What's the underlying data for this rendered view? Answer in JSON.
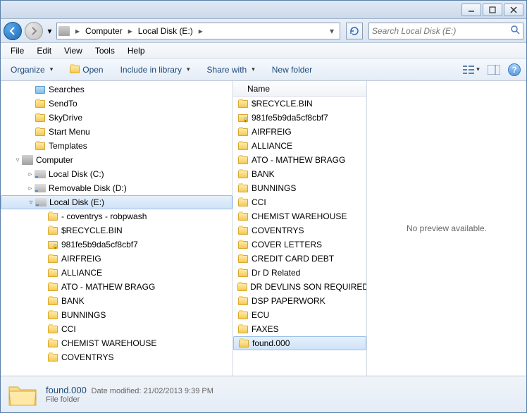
{
  "breadcrumb": [
    {
      "label": "Computer"
    },
    {
      "label": "Local Disk (E:)"
    }
  ],
  "search": {
    "placeholder": "Search Local Disk (E:)"
  },
  "menu": [
    "File",
    "Edit",
    "View",
    "Tools",
    "Help"
  ],
  "toolbar": {
    "organize": "Organize",
    "open": "Open",
    "library": "Include in library",
    "share": "Share with",
    "newfolder": "New folder"
  },
  "tree": [
    {
      "indent": 2,
      "icon": "search",
      "label": "Searches"
    },
    {
      "indent": 2,
      "icon": "folder",
      "label": "SendTo"
    },
    {
      "indent": 2,
      "icon": "folder",
      "label": "SkyDrive"
    },
    {
      "indent": 2,
      "icon": "folder",
      "label": "Start Menu"
    },
    {
      "indent": 2,
      "icon": "folder",
      "label": "Templates"
    },
    {
      "indent": 1,
      "exp": "▿",
      "icon": "computer",
      "label": "Computer"
    },
    {
      "indent": 2,
      "exp": "▹",
      "icon": "disk",
      "label": "Local Disk (C:)"
    },
    {
      "indent": 2,
      "exp": "▹",
      "icon": "disk",
      "label": "Removable Disk (D:)"
    },
    {
      "indent": 2,
      "exp": "▿",
      "icon": "disk",
      "label": "Local Disk (E:)",
      "selected": true
    },
    {
      "indent": 3,
      "icon": "folder",
      "label": "- coventrys - robpwash"
    },
    {
      "indent": 3,
      "icon": "folder",
      "label": "$RECYCLE.BIN"
    },
    {
      "indent": 3,
      "icon": "lock",
      "label": "981fe5b9da5cf8cbf7"
    },
    {
      "indent": 3,
      "icon": "folder",
      "label": "AIRFREIG"
    },
    {
      "indent": 3,
      "icon": "folder",
      "label": "ALLIANCE"
    },
    {
      "indent": 3,
      "icon": "folder",
      "label": "ATO - MATHEW BRAGG"
    },
    {
      "indent": 3,
      "icon": "folder",
      "label": "BANK"
    },
    {
      "indent": 3,
      "icon": "folder",
      "label": "BUNNINGS"
    },
    {
      "indent": 3,
      "icon": "folder",
      "label": "CCI"
    },
    {
      "indent": 3,
      "icon": "folder",
      "label": "CHEMIST WAREHOUSE"
    },
    {
      "indent": 3,
      "icon": "folder",
      "label": "COVENTRYS"
    }
  ],
  "list_header": "Name",
  "list": [
    {
      "icon": "folder",
      "label": "$RECYCLE.BIN"
    },
    {
      "icon": "lock",
      "label": "981fe5b9da5cf8cbf7"
    },
    {
      "icon": "folder",
      "label": "AIRFREIG"
    },
    {
      "icon": "folder",
      "label": "ALLIANCE"
    },
    {
      "icon": "folder",
      "label": "ATO - MATHEW BRAGG"
    },
    {
      "icon": "folder",
      "label": "BANK"
    },
    {
      "icon": "folder",
      "label": "BUNNINGS"
    },
    {
      "icon": "folder",
      "label": "CCI"
    },
    {
      "icon": "folder",
      "label": "CHEMIST WAREHOUSE"
    },
    {
      "icon": "folder",
      "label": "COVENTRYS"
    },
    {
      "icon": "folder",
      "label": "COVER LETTERS"
    },
    {
      "icon": "folder",
      "label": "CREDIT CARD DEBT"
    },
    {
      "icon": "folder",
      "label": "Dr D Related"
    },
    {
      "icon": "folder",
      "label": "DR DEVLINS SON REQUIRED"
    },
    {
      "icon": "folder",
      "label": "DSP PAPERWORK"
    },
    {
      "icon": "folder",
      "label": "ECU"
    },
    {
      "icon": "folder",
      "label": "FAXES"
    },
    {
      "icon": "folder",
      "label": "found.000",
      "selected": true
    }
  ],
  "preview_text": "No preview available.",
  "details": {
    "name": "found.000",
    "modified_label": "Date modified:",
    "modified": "21/02/2013 9:39 PM",
    "type": "File folder"
  }
}
